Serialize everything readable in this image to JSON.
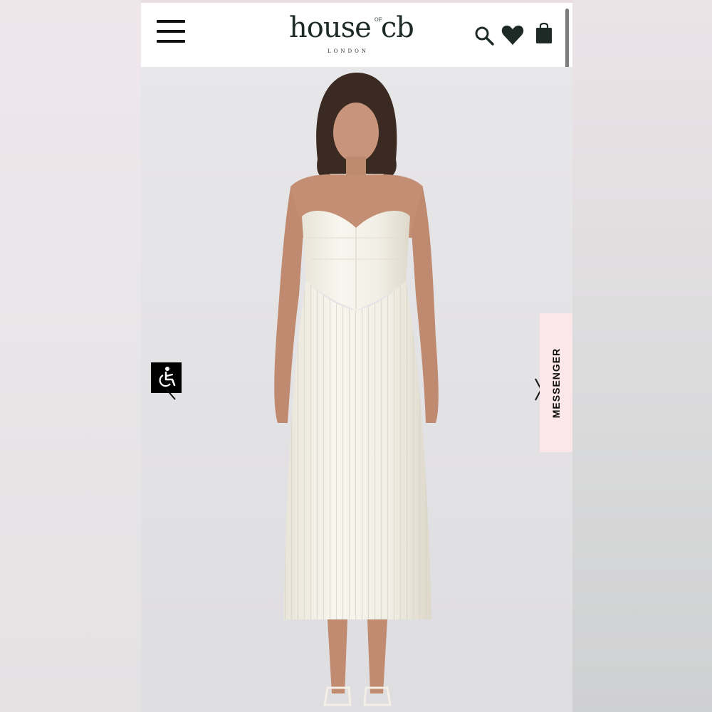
{
  "brand": {
    "logo_main": "houseofcb",
    "logo_word": "house",
    "logo_of": "OF",
    "logo_cb": "cb",
    "logo_sub": "LONDON"
  },
  "header": {
    "icons": [
      "menu-icon",
      "search-icon",
      "heart-icon",
      "shopping-bag-icon"
    ]
  },
  "product": {
    "image_alt": "Model wearing an ivory strapless pleated corset midi dress"
  },
  "widgets": {
    "messenger_label": "MESSENGER",
    "accessibility_icon": "accessibility-icon"
  },
  "colors": {
    "header_bg": "#ffffff",
    "brand_ink": "#1e2a26",
    "image_bg": "#e6e6e8",
    "messenger_bg": "#fbe6ea",
    "accessibility_bg": "#000000"
  }
}
